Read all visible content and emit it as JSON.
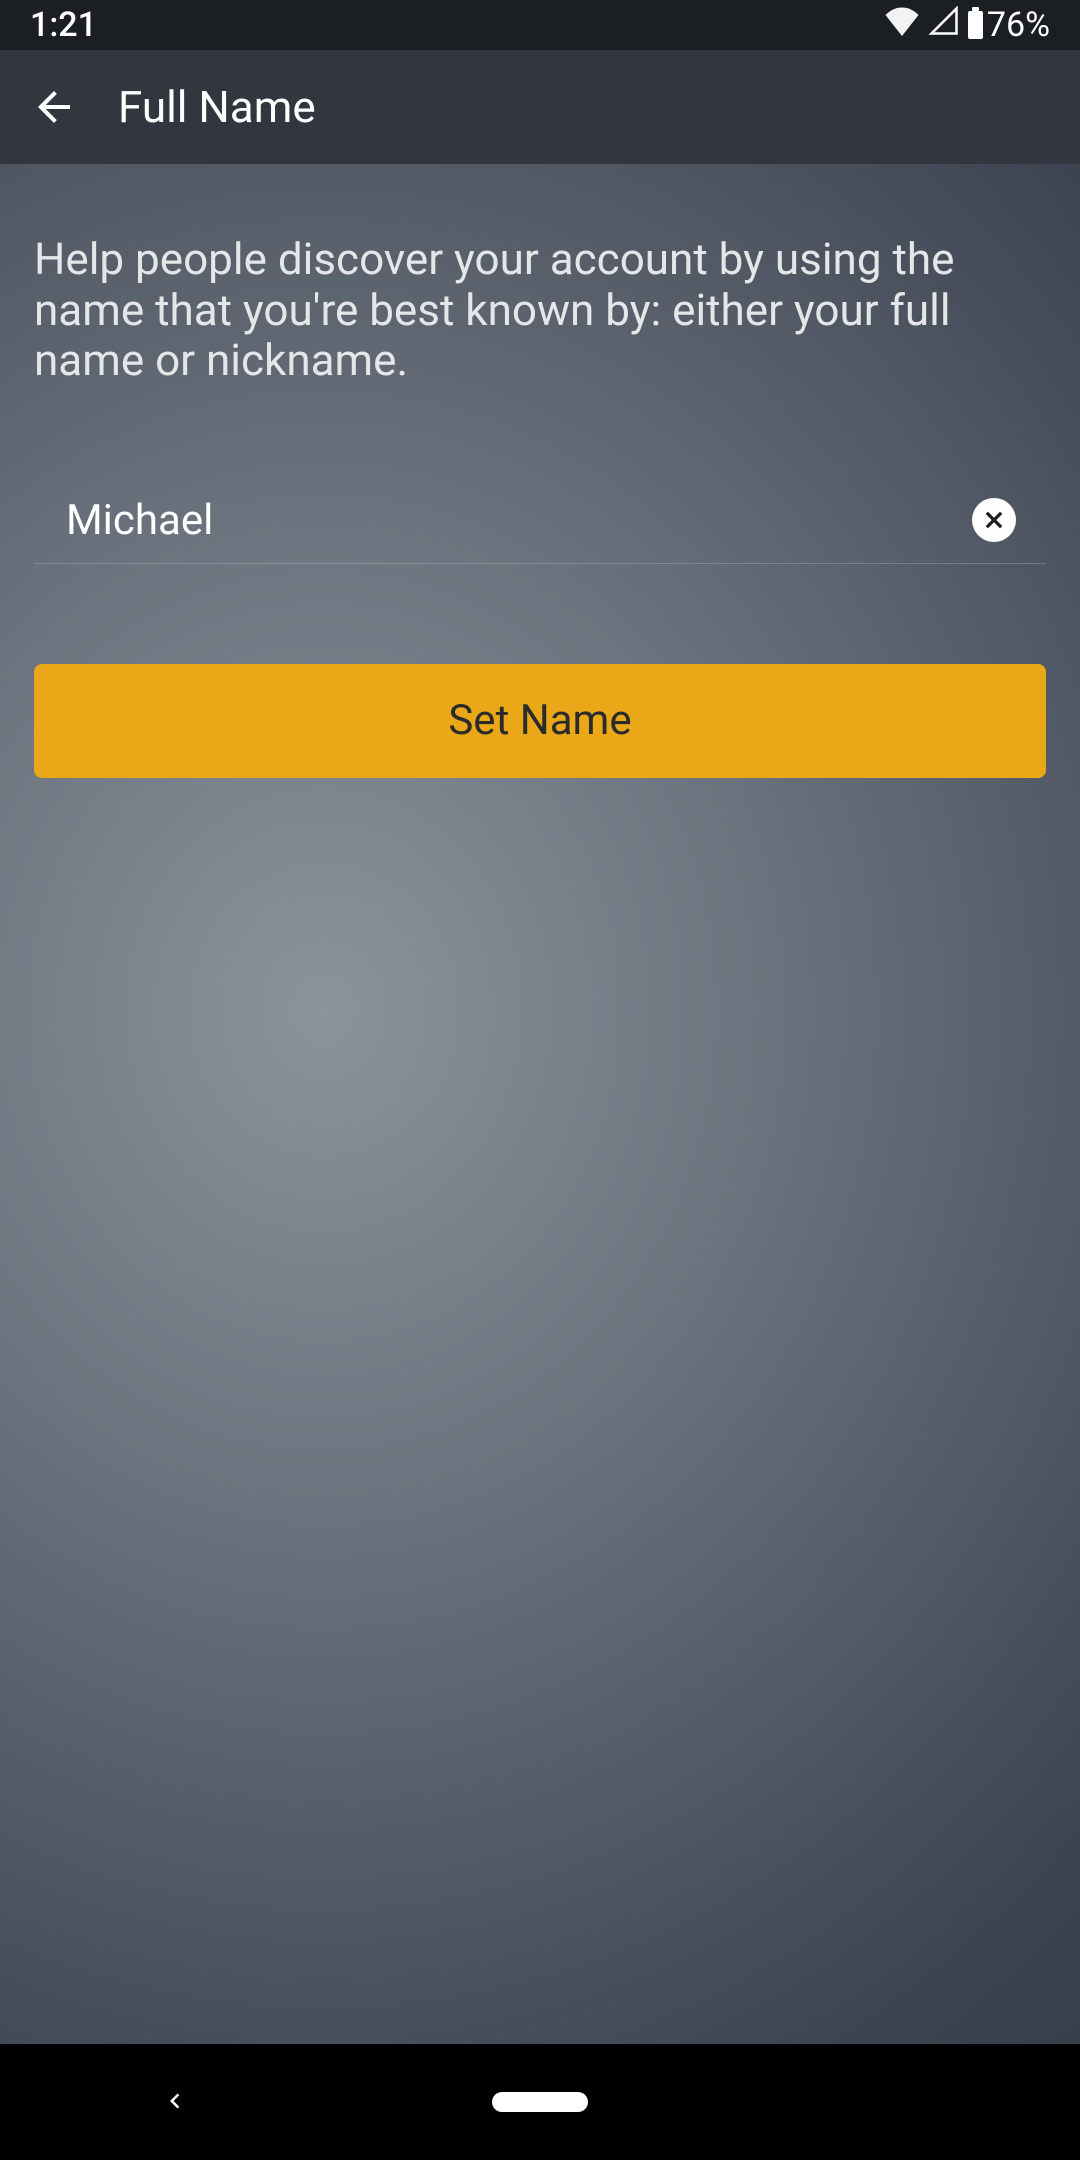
{
  "status": {
    "time": "1:21",
    "battery": "76%"
  },
  "header": {
    "title": "Full Name"
  },
  "main": {
    "description": "Help people discover your account by using the name that you're best known by: either your full name or nickname.",
    "name_value": "Michael",
    "button_label": "Set Name"
  }
}
